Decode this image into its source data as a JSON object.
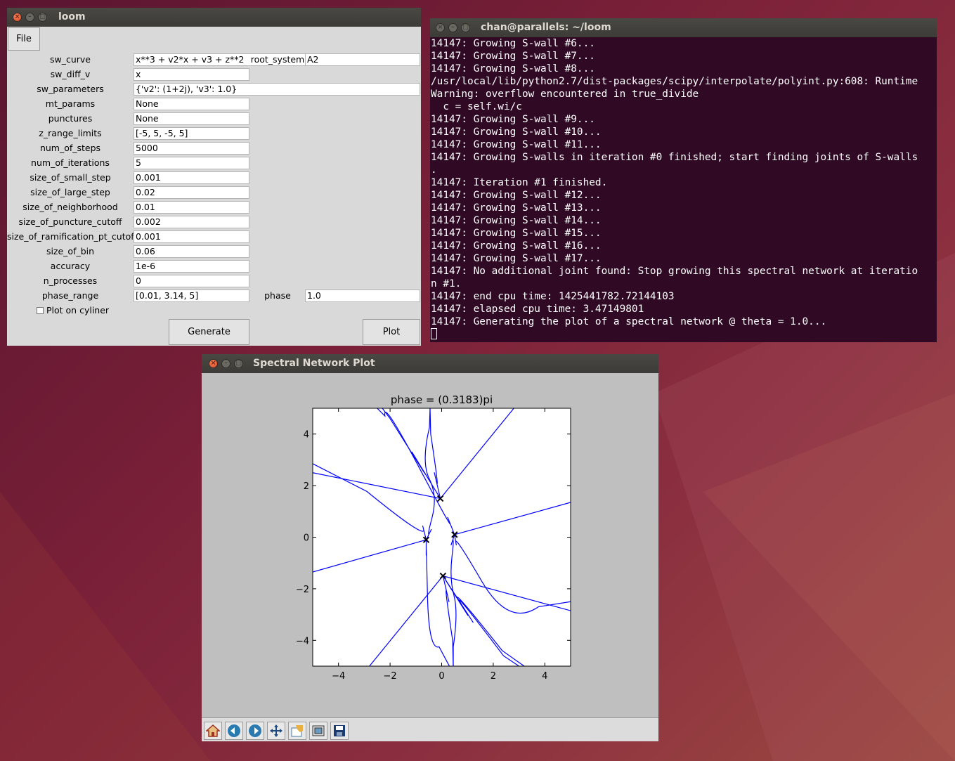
{
  "loom": {
    "title": "loom",
    "menu_file": "File",
    "fields": [
      {
        "label": "sw_curve",
        "value": "x**3 + v2*x + v3 + z**2"
      },
      {
        "label": "sw_diff_v",
        "value": "x"
      },
      {
        "label": "sw_parameters",
        "value": "{'v2': (1+2j), 'v3': 1.0}"
      },
      {
        "label": "mt_params",
        "value": "None"
      },
      {
        "label": "punctures",
        "value": "None"
      },
      {
        "label": "z_range_limits",
        "value": "[-5, 5, -5, 5]"
      },
      {
        "label": "num_of_steps",
        "value": "5000"
      },
      {
        "label": "num_of_iterations",
        "value": "5"
      },
      {
        "label": "size_of_small_step",
        "value": "0.001"
      },
      {
        "label": "size_of_large_step",
        "value": "0.02"
      },
      {
        "label": "size_of_neighborhood",
        "value": "0.01"
      },
      {
        "label": "size_of_puncture_cutoff",
        "value": "0.002"
      },
      {
        "label": "size_of_ramification_pt_cutoff",
        "value": "0.001"
      },
      {
        "label": "size_of_bin",
        "value": "0.06"
      },
      {
        "label": "accuracy",
        "value": "1e-6"
      },
      {
        "label": "n_processes",
        "value": "0"
      },
      {
        "label": "phase_range",
        "value": "[0.01, 3.14, 5]"
      }
    ],
    "root_system_label": "root_system",
    "root_system_value": "A2",
    "phase_label": "phase",
    "phase_value": "1.0",
    "plot_on_cylinder_label": "Plot on cyliner",
    "plot_on_cylinder_checked": false,
    "generate_label": "Generate",
    "plot_label": "Plot"
  },
  "terminal": {
    "title": "chan@parallels: ~/loom",
    "lines": [
      "14147: Growing S-wall #6...",
      "14147: Growing S-wall #7...",
      "14147: Growing S-wall #8...",
      "/usr/local/lib/python2.7/dist-packages/scipy/interpolate/polyint.py:608: Runtime",
      "Warning: overflow encountered in true_divide",
      "  c = self.wi/c",
      "14147: Growing S-wall #9...",
      "14147: Growing S-wall #10...",
      "14147: Growing S-wall #11...",
      "14147: Growing S-walls in iteration #0 finished; start finding joints of S-walls",
      ".",
      "14147: Iteration #1 finished.",
      "14147: Growing S-wall #12...",
      "14147: Growing S-wall #13...",
      "14147: Growing S-wall #14...",
      "14147: Growing S-wall #15...",
      "14147: Growing S-wall #16...",
      "14147: Growing S-wall #17...",
      "14147: No additional joint found: Stop growing this spectral network at iteratio",
      "n #1.",
      "14147: end cpu time: 1425441782.72144103",
      "14147: elapsed cpu time: 3.47149801",
      "14147: Generating the plot of a spectral network @ theta = 1.0..."
    ]
  },
  "plot_window": {
    "title": "Spectral Network Plot",
    "toolbar": [
      "home-icon",
      "back-icon",
      "forward-icon",
      "pan-icon",
      "zoom-icon",
      "subplots-icon",
      "save-icon"
    ]
  },
  "chart_data": {
    "type": "line",
    "title": "phase = (0.3183)pi",
    "xlim": [
      -5,
      5
    ],
    "ylim": [
      -5,
      5
    ],
    "xticks": [
      "−4",
      "−2",
      "0",
      "2",
      "4"
    ],
    "yticks": [
      "4",
      "2",
      "0",
      "−2",
      "−4"
    ],
    "xtick_values": [
      -4,
      -2,
      0,
      2,
      4
    ],
    "ytick_values": [
      4,
      2,
      0,
      -2,
      -4
    ],
    "branch_points": [
      [
        -0.6,
        -0.1
      ],
      [
        -0.05,
        1.5
      ],
      [
        0.5,
        0.1
      ],
      [
        0.05,
        -1.5
      ]
    ],
    "walls": [
      [
        [
          -0.05,
          1.5
        ],
        [
          2.8,
          5
        ]
      ],
      [
        [
          -0.05,
          1.5
        ],
        [
          -5,
          2.5
        ]
      ],
      [
        [
          -0.05,
          1.5
        ],
        [
          -0.4,
          3
        ],
        [
          -0.45,
          5
        ]
      ],
      [
        [
          -0.05,
          1.5
        ],
        [
          -1.7,
          4.2
        ],
        [
          -2.3,
          5
        ]
      ],
      [
        [
          -0.6,
          -0.1
        ],
        [
          -5,
          -1.35
        ]
      ],
      [
        [
          -0.6,
          -0.1
        ],
        [
          -0.8,
          0.7
        ],
        [
          -5,
          2.85
        ]
      ],
      [
        [
          -0.6,
          -0.1
        ],
        [
          -0.3,
          0.5
        ],
        [
          -0.45,
          1.0
        ],
        [
          -0.5,
          3.5
        ],
        [
          -0.45,
          5
        ]
      ],
      [
        [
          -0.6,
          -0.1
        ],
        [
          -0.6,
          -1.0
        ],
        [
          -0.5,
          -3.5
        ],
        [
          0.3,
          -5
        ]
      ],
      [
        [
          0.5,
          0.1
        ],
        [
          5,
          1.35
        ]
      ],
      [
        [
          0.5,
          0.1
        ],
        [
          0.6,
          -0.5
        ],
        [
          2.5,
          -2.9
        ],
        [
          5,
          -2.5
        ]
      ],
      [
        [
          0.5,
          0.1
        ],
        [
          0.3,
          -0.5
        ],
        [
          0.5,
          -1.0
        ],
        [
          0.45,
          -3.5
        ],
        [
          0.45,
          -5
        ]
      ],
      [
        [
          0.5,
          0.1
        ],
        [
          0.1,
          1.1
        ],
        [
          -1.9,
          4.4
        ],
        [
          -2.5,
          5
        ]
      ],
      [
        [
          0.05,
          -1.5
        ],
        [
          -2.8,
          -5
        ]
      ],
      [
        [
          0.05,
          -1.5
        ],
        [
          5,
          -2.85
        ]
      ],
      [
        [
          0.05,
          -1.5
        ],
        [
          0.4,
          -3
        ],
        [
          0.45,
          -5
        ]
      ],
      [
        [
          0.05,
          -1.5
        ],
        [
          1.8,
          -4.2
        ],
        [
          3.0,
          -5
        ]
      ],
      [
        [
          0.05,
          -1.5
        ],
        [
          1.5,
          -3.8
        ],
        [
          3.2,
          -5
        ]
      ]
    ]
  }
}
